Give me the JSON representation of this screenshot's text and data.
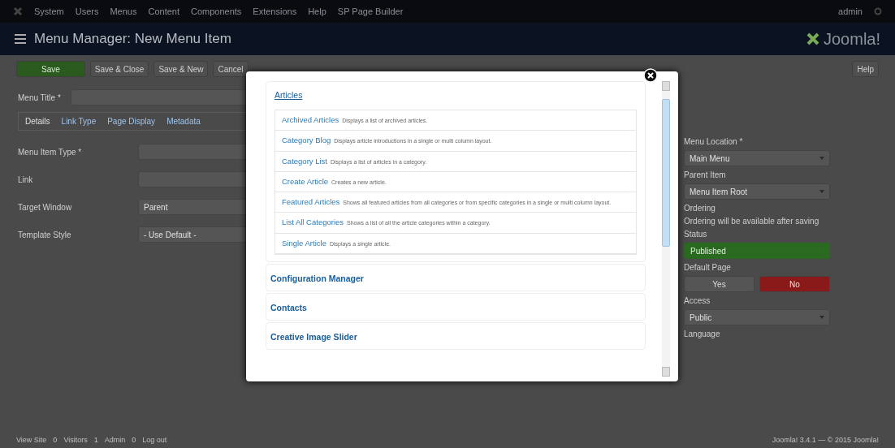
{
  "top_menu": {
    "items": [
      "System",
      "Users",
      "Menus",
      "Content",
      "Components",
      "Extensions",
      "Help",
      "SP Page Builder"
    ],
    "user": "admin"
  },
  "header": {
    "title": "Menu Manager: New Menu Item",
    "logo_text": "Joomla!"
  },
  "toolbar": {
    "buttons": [
      {
        "label": "Save",
        "kind": "primary"
      },
      {
        "label": "Save & Close",
        "kind": "plain"
      },
      {
        "label": "Save & New",
        "kind": "plain"
      },
      {
        "label": "Cancel",
        "kind": "plain"
      }
    ],
    "help": "Help"
  },
  "form": {
    "title_label": "Menu Title *",
    "tabs": [
      {
        "label": "Details",
        "selected": true
      },
      {
        "label": "Link Type",
        "selected": false
      },
      {
        "label": "Page Display",
        "selected": false
      },
      {
        "label": "Metadata",
        "selected": false
      }
    ],
    "fields": [
      {
        "label": "Menu Item Type *",
        "kind": "input"
      },
      {
        "label": "Link",
        "kind": "input"
      },
      {
        "label": "Target Window",
        "kind": "select",
        "value": "Parent"
      },
      {
        "label": "Template Style",
        "kind": "select",
        "value": "- Use Default -"
      }
    ]
  },
  "side": {
    "fields": [
      {
        "label": "Menu Location *",
        "kind": "select",
        "value": "Main Menu"
      },
      {
        "label": "Parent Item",
        "kind": "select",
        "value": "Menu Item Root"
      },
      {
        "label": "Ordering",
        "kind": "note",
        "value": "Ordering will be available after saving"
      },
      {
        "label": "Status",
        "kind": "status",
        "value": "Published"
      },
      {
        "label": "Default Page",
        "kind": "toggle",
        "options": [
          {
            "label": "Yes",
            "selected": false
          },
          {
            "label": "No",
            "selected": true
          }
        ]
      },
      {
        "label": "Access",
        "kind": "select",
        "value": "Public"
      },
      {
        "label": "Language",
        "kind": "cut"
      }
    ]
  },
  "modal": {
    "groups": [
      {
        "title": "Articles",
        "expanded": true,
        "items": [
          {
            "name": "Archived Articles",
            "desc": "Displays a list of archived articles."
          },
          {
            "name": "Category Blog",
            "desc": "Displays article introductions in a single or multi column layout."
          },
          {
            "name": "Category List",
            "desc": "Displays a list of articles in a category."
          },
          {
            "name": "Create Article",
            "desc": "Creates a new article."
          },
          {
            "name": "Featured Articles",
            "desc": "Shows all featured articles from all categories or from specific categories in a single or multi column layout."
          },
          {
            "name": "List All Categories",
            "desc": "Shows a list of all the article categories within a category."
          },
          {
            "name": "Single Article",
            "desc": "Displays a single article."
          }
        ]
      },
      {
        "title": "Configuration Manager",
        "expanded": false
      },
      {
        "title": "Contacts",
        "expanded": false
      },
      {
        "title": "Creative Image Slider",
        "expanded": false
      }
    ]
  },
  "status_bar": {
    "items": [
      "View Site",
      "0",
      "Visitors",
      "1",
      "Admin",
      "0",
      "Log out"
    ],
    "version": "Joomla! 3.4.1 — © 2015 Joomla!"
  }
}
